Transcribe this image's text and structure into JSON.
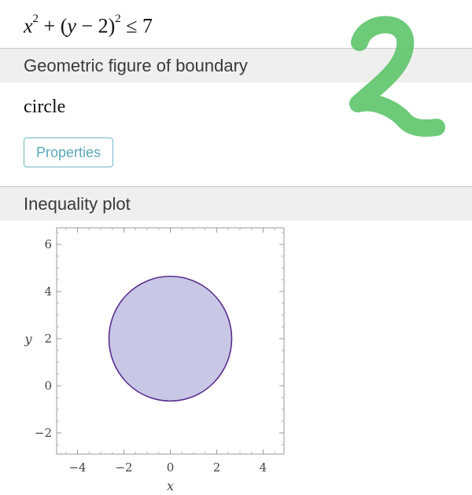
{
  "equation": {
    "x": "x",
    "exp1": "2",
    "plus": " + (",
    "y": "y",
    "rest": " − 2)",
    "exp2": "2",
    "le": " ≤ 7"
  },
  "sections": {
    "boundary": {
      "header": "Geometric figure of boundary",
      "value": "circle",
      "button": "Properties"
    },
    "plot": {
      "header": "Inequality plot"
    }
  },
  "annotation": {
    "text": "2",
    "color": "#5cc46a"
  },
  "chart_data": {
    "type": "area",
    "title": "",
    "xlabel": "x",
    "ylabel": "y",
    "xlim": [
      -4.9,
      4.9
    ],
    "ylim": [
      -2.9,
      6.7
    ],
    "xticks": [
      -4,
      -2,
      0,
      2,
      4
    ],
    "yticks": [
      -2,
      0,
      2,
      4,
      6
    ],
    "xtick_labels": [
      "−4",
      "−2",
      "0",
      "2",
      "4"
    ],
    "ytick_labels": [
      "−2",
      "0",
      "2",
      "4",
      "6"
    ],
    "region": {
      "shape": "circle",
      "center": [
        0,
        2
      ],
      "radius": 2.6458
    },
    "fill_color": "#c8c8e6",
    "stroke_color": "#5b2d8e",
    "grid": false
  }
}
